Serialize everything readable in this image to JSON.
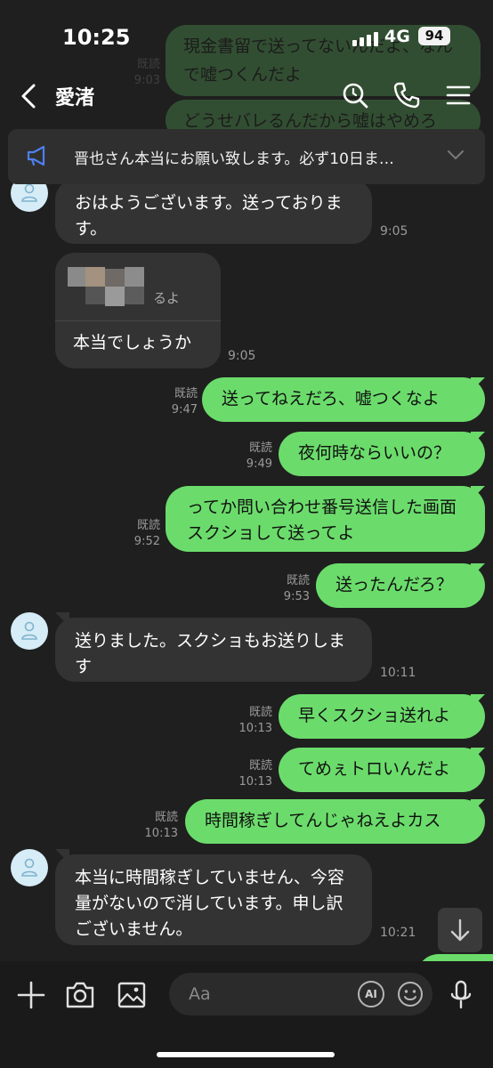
{
  "status": {
    "time": "10:25",
    "network": "4G",
    "battery": "94"
  },
  "header": {
    "title": "愛渚"
  },
  "ghost_messages": [
    {
      "text": "現金書留で送ってないんだよ、なんで嘘つくんだよ"
    },
    {
      "text": "どうせバレるんだから嘘はやめろ"
    }
  ],
  "ghost_meta": {
    "read": "既読",
    "time": "9:03"
  },
  "announcement": {
    "text": "晋也さん本当にお願い致します。必ず10日ま…"
  },
  "messages": [
    {
      "side": "left",
      "text": "おはようございます。送っております。",
      "time": "9:05"
    },
    {
      "side": "left",
      "quote_text": "るよ",
      "text": "本当でしょうか",
      "time": "9:05"
    },
    {
      "side": "right",
      "text": "送ってねえだろ、嘘つくなよ",
      "read": "既読",
      "time": "9:47"
    },
    {
      "side": "right",
      "text": "夜何時ならいいの？",
      "read": "既読",
      "time": "9:49"
    },
    {
      "side": "right",
      "text": "ってか問い合わせ番号送信した画面スクショして送ってよ",
      "read": "既読",
      "time": "9:52"
    },
    {
      "side": "right",
      "text": "送ったんだろ？",
      "read": "既読",
      "time": "9:53"
    },
    {
      "side": "left",
      "text": "送りました。スクショもお送りします",
      "time": "10:11"
    },
    {
      "side": "right",
      "text": "早くスクショ送れよ",
      "read": "既読",
      "time": "10:13"
    },
    {
      "side": "right",
      "text": "てめぇトロいんだよ",
      "read": "既読",
      "time": "10:13"
    },
    {
      "side": "right",
      "text": "時間稼ぎしてんじゃねえよカス",
      "read": "既読",
      "time": "10:13"
    },
    {
      "side": "left",
      "text": "本当に時間稼ぎしていません、今容量がないので消しています。申し訳ございません。",
      "time": "10:21"
    }
  ],
  "input": {
    "placeholder": "Aa",
    "ai_label": "AI"
  },
  "colors": {
    "outgoing": "#6bdc6b",
    "incoming": "#333333",
    "background": "#1f1f1f"
  }
}
